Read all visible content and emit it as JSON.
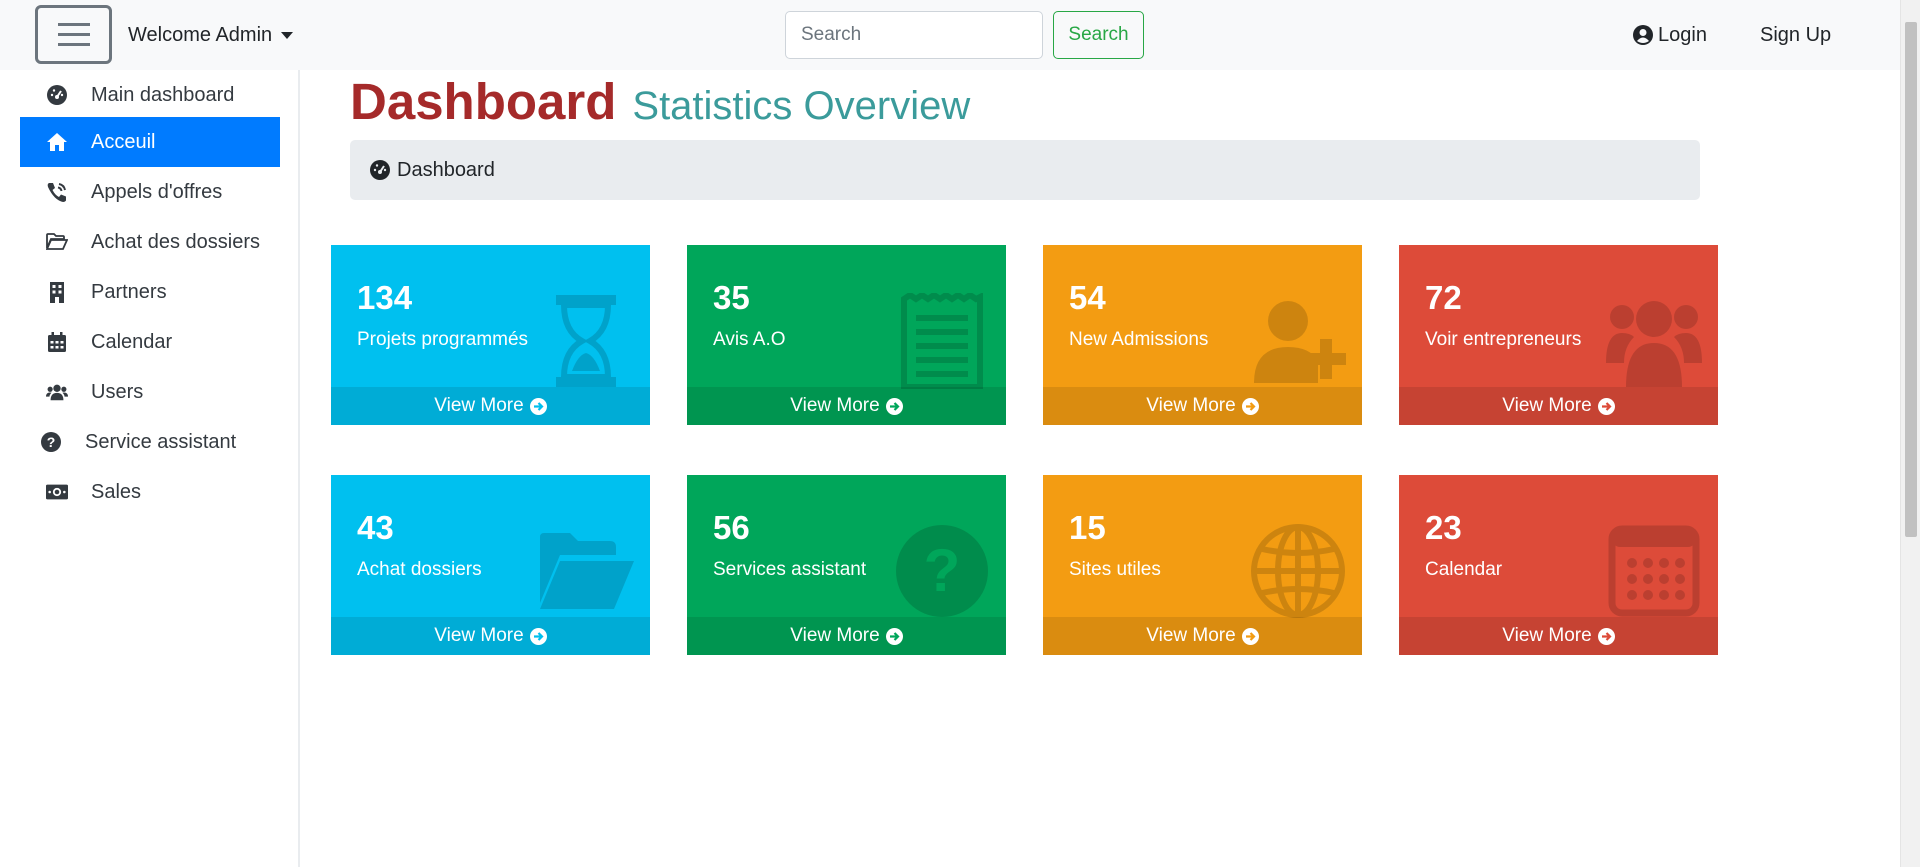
{
  "navbar": {
    "brand_label": "Welcome Admin",
    "search_placeholder": "Search",
    "search_button": "Search",
    "login_label": "Login",
    "signup_label": "Sign Up"
  },
  "sidebar": {
    "active_color": "#007bff",
    "items": [
      {
        "label": "Main dashboard",
        "icon": "dashboard-gauge-icon"
      },
      {
        "label": "Acceuil",
        "icon": "home-icon",
        "active": true
      },
      {
        "label": "Appels d'offres",
        "icon": "phone-volume-icon"
      },
      {
        "label": "Achat des dossiers",
        "icon": "folder-open-icon"
      },
      {
        "label": "Partners",
        "icon": "building-icon"
      },
      {
        "label": "Calendar",
        "icon": "calendar-icon"
      },
      {
        "label": "Users",
        "icon": "users-icon"
      },
      {
        "label": "Service assistant",
        "icon": "question-circle-icon"
      },
      {
        "label": "Sales",
        "icon": "money-bill-icon"
      }
    ]
  },
  "header": {
    "title": "Dashboard",
    "subtitle": "Statistics Overview",
    "breadcrumb": "Dashboard"
  },
  "cards": [
    {
      "value": "134",
      "label": "Projets programmés",
      "link": "View More",
      "color": "#00c0ef",
      "icon": "hourglass-icon"
    },
    {
      "value": "35",
      "label": "Avis A.O",
      "link": "View More",
      "color": "#00a65a",
      "icon": "receipt-icon"
    },
    {
      "value": "54",
      "label": "New Admissions",
      "link": "View More",
      "color": "#f39c12",
      "icon": "user-plus-icon"
    },
    {
      "value": "72",
      "label": "Voir entrepreneurs",
      "link": "View More",
      "color": "#dd4b39",
      "icon": "users-icon"
    },
    {
      "value": "43",
      "label": "Achat dossiers",
      "link": "View More",
      "color": "#00c0ef",
      "icon": "folder-open-icon"
    },
    {
      "value": "56",
      "label": "Services assistant",
      "link": "View More",
      "color": "#00a65a",
      "icon": "question-circle-icon"
    },
    {
      "value": "15",
      "label": "Sites utiles",
      "link": "View More",
      "color": "#f39c12",
      "icon": "globe-icon"
    },
    {
      "value": "23",
      "label": "Calendar",
      "link": "View More",
      "color": "#dd4b39",
      "icon": "calendar-icon"
    }
  ]
}
